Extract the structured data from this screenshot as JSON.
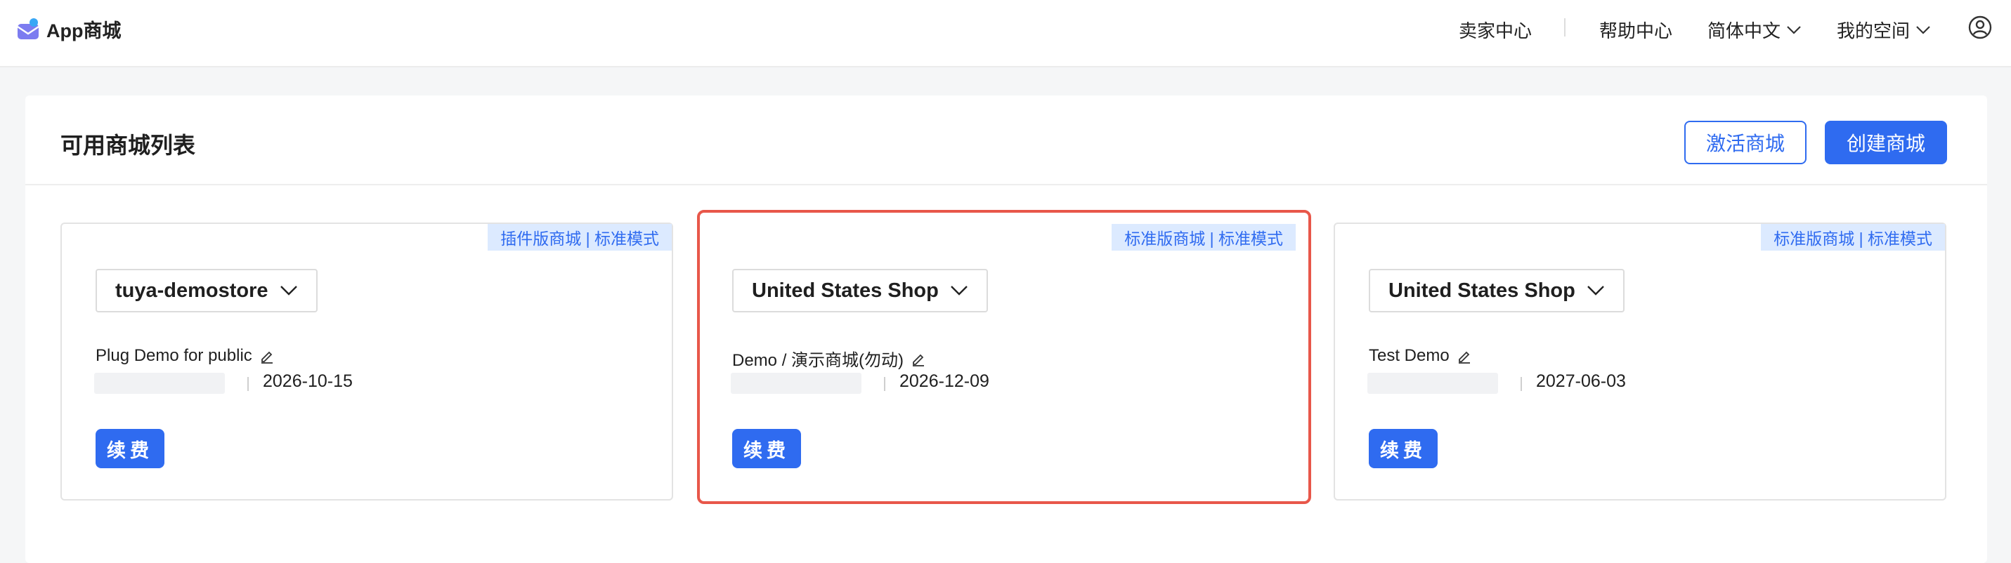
{
  "header": {
    "logo_text": "App商城",
    "nav": {
      "seller_center": "卖家中心",
      "help_center": "帮助中心",
      "language": "简体中文",
      "my_space": "我的空间"
    }
  },
  "page": {
    "title": "可用商城列表",
    "activate_button": "激活商城",
    "create_button": "创建商城"
  },
  "stores": [
    {
      "tag": "插件版商城 | 标准模式",
      "store_name": "tuya-demostore",
      "description": "Plug Demo for public",
      "expiry": "2026-10-15",
      "renew_label": "续费",
      "selected": false
    },
    {
      "tag": "标准版商城 | 标准模式",
      "store_name": "United States Shop",
      "description": "Demo / 演示商城(勿动)",
      "expiry": "2026-12-09",
      "renew_label": "续费",
      "selected": true
    },
    {
      "tag": "标准版商城 | 标准模式",
      "store_name": "United States Shop",
      "description": "Test Demo",
      "expiry": "2027-06-03",
      "renew_label": "续费",
      "selected": false
    }
  ],
  "colors": {
    "primary": "#2f6bf0",
    "tag_background": "#dceaff",
    "selection_border": "#e8574a"
  },
  "icons": [
    "app-store-logo-icon",
    "chevron-down-icon",
    "user-avatar-icon",
    "edit-pencil-icon"
  ]
}
